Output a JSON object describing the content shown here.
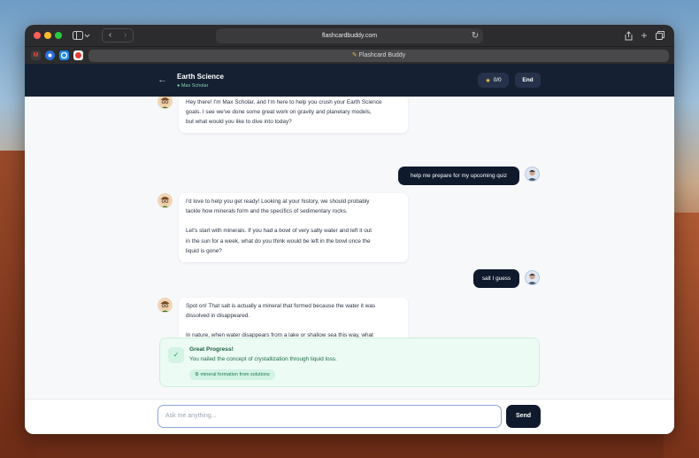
{
  "browser": {
    "url": "flashcardbuddy.com",
    "tab_title": "Flashcard Buddy",
    "tab_icon": "✎",
    "favicons": [
      "M",
      "",
      "",
      ""
    ]
  },
  "header": {
    "back_icon": "←",
    "title": "Earth Science",
    "subtitle": "● Max Scholar",
    "score_icon": "★",
    "score": "0/0",
    "end_label": "End"
  },
  "messages": [
    {
      "role": "ai",
      "paragraphs": [
        "Hey there! I'm Max Scholar, and I'm here to help you crush your Earth Science\ngoals. I see we've done some great work on gravity and planetary models,\nbut what would you like to dive into today?"
      ]
    },
    {
      "role": "user",
      "text": "help me prepare for my upcoming quiz"
    },
    {
      "role": "ai",
      "paragraphs": [
        "I'd love to help you get ready! Looking at your history, we should probably\ntackle how minerals form and the specifics of sedimentary rocks.",
        "Let's start with minerals. If you had a bowl of very salty water and left it out\nin the sun for a week, what do you think would be left in the bowl once the\nliquid is gone?"
      ]
    },
    {
      "role": "user",
      "text": "salt I guess"
    },
    {
      "role": "ai",
      "paragraphs": [
        "Spot on! That salt is actually a mineral that formed because the water it was\ndissolved in disappeared.",
        "In nature, when water disappears from a lake or shallow sea this way, what\ndo we call that specific process?"
      ]
    }
  ],
  "progress": {
    "check_icon": "✓",
    "title": "Great Progress!",
    "text": "You nailed the concept of crystallization through liquid loss.",
    "tag": "⚙ mineral formation from solutions"
  },
  "composer": {
    "placeholder": "Ask me anything...",
    "send_label": "Send"
  },
  "colors": {
    "header_bg": "#152033",
    "user_bubble": "#0f1a2c",
    "progress_bg": "#ecfbf4",
    "accent_green": "#1f9a63"
  }
}
